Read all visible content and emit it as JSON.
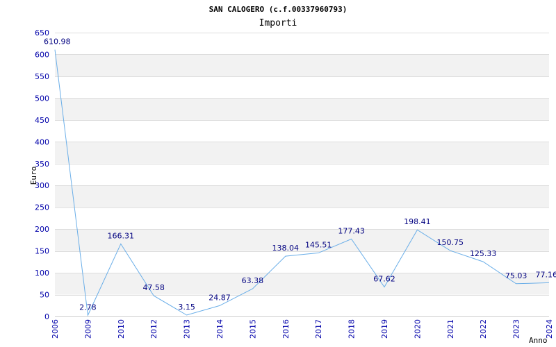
{
  "chart_data": {
    "type": "line",
    "title": "SAN CALOGERO (c.f.00337960793)",
    "subtitle": "Importi",
    "xlabel": "Anno",
    "ylabel": "Euro",
    "ylim": [
      0,
      650
    ],
    "yticks": [
      0,
      50,
      100,
      150,
      200,
      250,
      300,
      350,
      400,
      450,
      500,
      550,
      600,
      650
    ],
    "categories": [
      "2006",
      "2009",
      "2010",
      "2012",
      "2013",
      "2014",
      "2015",
      "2016",
      "2017",
      "2018",
      "2019",
      "2020",
      "2021",
      "2022",
      "2023",
      "2024"
    ],
    "series": [
      {
        "values": [
          610.98,
          2.78,
          166.31,
          47.58,
          3.15,
          24.87,
          63.38,
          138.04,
          145.51,
          177.43,
          67.62,
          198.41,
          150.75,
          125.33,
          75.03,
          77.16
        ],
        "labels": [
          "610.98",
          "2.78",
          "166.31",
          "47.58",
          "3.15",
          "24.87",
          "63.38",
          "138.04",
          "145.51",
          "177.43",
          "67.62",
          "198.41",
          "150.75",
          "125.33",
          "75.03",
          "77.16"
        ]
      }
    ],
    "grid": true,
    "colors": {
      "line": "#6aaee8",
      "band": "#f2f2f2",
      "gridline": "#dddddd",
      "tick_text": "#0000aa",
      "label_text": "#000080"
    }
  }
}
